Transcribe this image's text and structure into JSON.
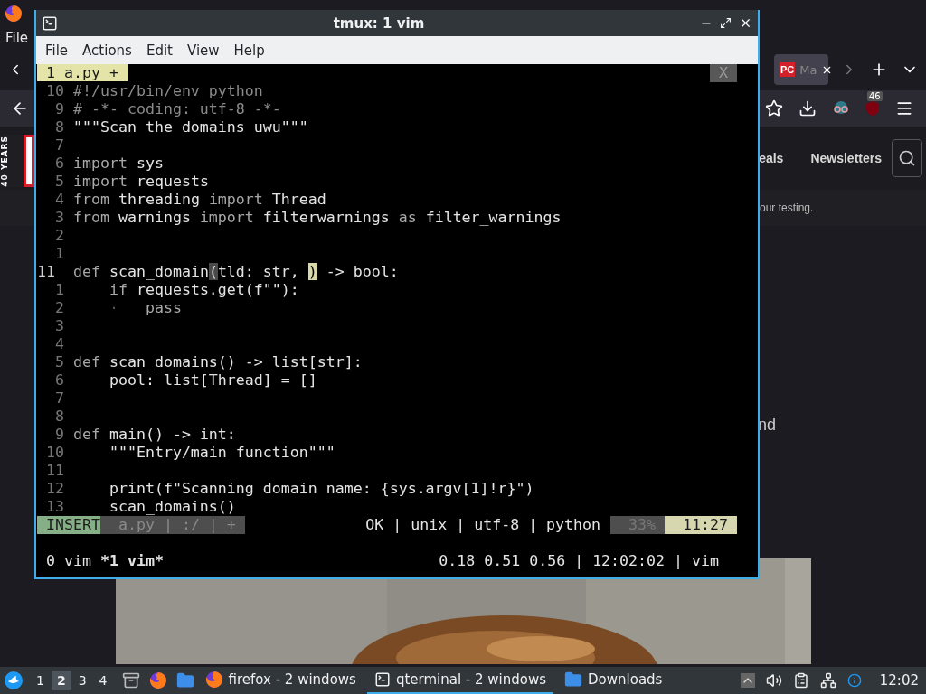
{
  "background_window": {
    "menu": [
      "File"
    ],
    "tab": {
      "logo": "PC",
      "label": "Ma"
    },
    "badge": "46",
    "side_logo": "40 YEARS",
    "nav_links": [
      "eals",
      "Newsletters"
    ],
    "article_text": [
      "our testing.",
      "nd"
    ],
    "photo": {
      "kind": "picture"
    }
  },
  "terminal": {
    "title": "tmux: 1 vim",
    "menu": [
      "File",
      "Actions",
      "Edit",
      "View",
      "Help"
    ],
    "vim": {
      "tabs": [
        {
          "label": "1 a.py +",
          "selected": true
        }
      ],
      "tab_close": "X",
      "lines": [
        {
          "number": "10",
          "current": false,
          "segments": [
            {
              "text": "#!/usr/bin/env python",
              "kind": "comment"
            }
          ]
        },
        {
          "number": "9",
          "current": false,
          "segments": [
            {
              "text": "# -*- coding: utf-8 -*-",
              "kind": "comment"
            }
          ]
        },
        {
          "number": "8",
          "current": false,
          "segments": [
            {
              "text": "\"\"\"Scan the domains uwu\"\"\"",
              "kind": "plain"
            }
          ]
        },
        {
          "number": "7",
          "current": false
        },
        {
          "number": "6",
          "current": false,
          "segments": [
            {
              "text": "import",
              "kind": "kw"
            },
            {
              "text": " sys",
              "kind": "plain"
            }
          ]
        },
        {
          "number": "5",
          "current": false,
          "segments": [
            {
              "text": "import",
              "kind": "kw"
            },
            {
              "text": " requests",
              "kind": "plain"
            }
          ]
        },
        {
          "number": "4",
          "current": false,
          "segments": [
            {
              "text": "from",
              "kind": "kw"
            },
            {
              "text": " threading ",
              "kind": "plain"
            },
            {
              "text": "import",
              "kind": "kw"
            },
            {
              "text": " Thread",
              "kind": "plain"
            }
          ]
        },
        {
          "number": "3",
          "current": false,
          "segments": [
            {
              "text": "from",
              "kind": "kw"
            },
            {
              "text": " warnings ",
              "kind": "plain"
            },
            {
              "text": "import",
              "kind": "kw"
            },
            {
              "text": " filterwarnings ",
              "kind": "plain"
            },
            {
              "text": "as",
              "kind": "kw"
            },
            {
              "text": " filter_warnings",
              "kind": "plain"
            }
          ]
        },
        {
          "number": "2",
          "current": false
        },
        {
          "number": "1",
          "current": false
        },
        {
          "number": "11",
          "current": true,
          "segments": [
            {
              "text": "def",
              "kind": "kw"
            },
            {
              "text": " scan_domain",
              "kind": "plain"
            },
            {
              "text": "(",
              "kind": "match"
            },
            {
              "text": "tld: str, ",
              "kind": "plain"
            },
            {
              "text": ")",
              "kind": "cursor"
            },
            {
              "text": " -> bool:",
              "kind": "plain"
            }
          ]
        },
        {
          "number": "1",
          "current": false,
          "segments": [
            {
              "text": "    if",
              "kind": "kw"
            },
            {
              "text": " requests.get(f\"\"):",
              "kind": "plain"
            }
          ]
        },
        {
          "number": "2",
          "current": false,
          "segments": [
            {
              "text": "    ·   ",
              "kind": "whitespace"
            },
            {
              "text": "pass",
              "kind": "kw"
            }
          ]
        },
        {
          "number": "3",
          "current": false
        },
        {
          "number": "4",
          "current": false
        },
        {
          "number": "5",
          "current": false,
          "segments": [
            {
              "text": "def",
              "kind": "kw"
            },
            {
              "text": " scan_domains() -> list[str]:",
              "kind": "plain"
            }
          ]
        },
        {
          "number": "6",
          "current": false,
          "segments": [
            {
              "text": "    pool: list[Thread] = []",
              "kind": "plain"
            }
          ]
        },
        {
          "number": "7",
          "current": false
        },
        {
          "number": "8",
          "current": false
        },
        {
          "number": "9",
          "current": false,
          "segments": [
            {
              "text": "def",
              "kind": "kw"
            },
            {
              "text": " main() -> int:",
              "kind": "plain"
            }
          ]
        },
        {
          "number": "10",
          "current": false,
          "segments": [
            {
              "text": "    \"\"\"Entry/main function\"\"\"",
              "kind": "plain"
            }
          ]
        },
        {
          "number": "11",
          "current": false
        },
        {
          "number": "12",
          "current": false,
          "segments": [
            {
              "text": "    print(f\"Scanning domain name: {sys.argv[1]!r}\")",
              "kind": "plain"
            }
          ]
        },
        {
          "number": "13",
          "current": false,
          "segments": [
            {
              "text": "    scan_domains()",
              "kind": "plain"
            }
          ]
        }
      ],
      "status": {
        "mode": "INSERT",
        "file_info": "a.py | :/ | +",
        "info": "OK | unix | utf-8 | python",
        "percent": "33%",
        "position": "11:27"
      }
    },
    "tmux": {
      "windows": [
        {
          "label": "0 vim",
          "selected": false
        },
        {
          "label": "*1 vim*",
          "selected": true
        }
      ],
      "status_right": "0.18 0.51 0.56 | 12:02:02 | vim"
    }
  },
  "taskbar": {
    "workspaces": [
      {
        "label": "1",
        "selected": false
      },
      {
        "label": "2",
        "selected": true
      },
      {
        "label": "3",
        "selected": false
      },
      {
        "label": "4",
        "selected": false
      }
    ],
    "tasks": [
      {
        "label": "firefox - 2 windows",
        "kind": "browser",
        "selected": false
      },
      {
        "label": "qterminal - 2 windows",
        "kind": "terminal",
        "selected": true
      },
      {
        "label": "Downloads",
        "kind": "folder",
        "selected": false
      }
    ],
    "clock": "12:02"
  }
}
